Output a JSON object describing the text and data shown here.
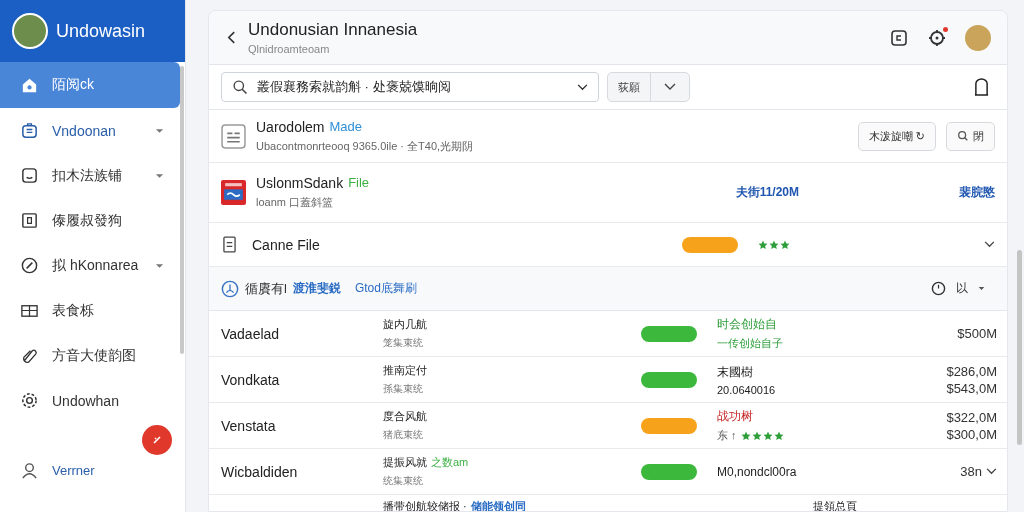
{
  "sidebar": {
    "brand": "Undowasin",
    "items": [
      {
        "label": "陌阅ck",
        "selected": true,
        "has_caret": false
      },
      {
        "label": "Vndoonan",
        "selected": false,
        "has_caret": true
      },
      {
        "label": "扣木法族铺",
        "selected": false,
        "has_caret": true
      },
      {
        "label": "傣履叔發狗",
        "selected": false,
        "has_caret": false
      },
      {
        "label": "拟 hKonnarea",
        "selected": false,
        "has_caret": true
      },
      {
        "label": "表食栎",
        "selected": false,
        "has_caret": false
      },
      {
        "label": "方音大使韵图",
        "selected": false,
        "has_caret": false
      },
      {
        "label": "Undowhan",
        "selected": false,
        "has_caret": false
      }
    ],
    "footer": "Verrner"
  },
  "header": {
    "title": "Undonusian Innanesia",
    "subtitle": "Qlnidroamteoam",
    "notification": true
  },
  "toolbar": {
    "search_value": "叢假襄務索就韵斛 · 处褒兢馍晌阅",
    "split_button": "荻願"
  },
  "files": [
    {
      "kind": "doc",
      "title": "Uarodolem",
      "tag": "Made",
      "subtitle": "Ubacontmonrteooq 9365.0ile · 全T40,光期阴",
      "actions": [
        "木泼旋嘲 ↻",
        "閉"
      ]
    },
    {
      "kind": "logo",
      "title": "UslonmSdank",
      "tag": "File",
      "subtitle": "loanm 口蓋斜篮",
      "size": "夫街11/20M",
      "link": "裴脘愍"
    },
    {
      "kind": "plain",
      "title": "Canne File",
      "color": "#f7a21b",
      "stars": 3
    }
  ],
  "section": {
    "title": "循賡有l",
    "link": "渡淮斐鋭",
    "note": "Gtod底舞刷",
    "filter": "以"
  },
  "rows": [
    {
      "name": "Vadaelad",
      "line_1": "旋内几航",
      "line_2": "笼集束统",
      "color": "#3cb93c",
      "detail_1": "时会创始自",
      "detail_2": "一传创始自子",
      "kind": "good",
      "amount_1": "$500M"
    },
    {
      "name": "Vondkata",
      "line_1": "推南定付",
      "line_2": "孫集束统",
      "color": "#3cb93c",
      "detail_1": "末國樹",
      "detail_2": "20.0640016",
      "kind": "plain",
      "amount_1": "$286,0M",
      "amount_2": "$543,0M"
    },
    {
      "name": "Venstata",
      "line_1": "度合风航",
      "line_2": "猪底束统",
      "color": "#f7a21b",
      "detail_1": "战功树",
      "detail_2": "东 ↑",
      "kind": "bad",
      "stars": 4,
      "amount_1": "$322,0M",
      "amount_2": "$300,0M"
    },
    {
      "name": "Wicbaldiden",
      "line_1": "提振风就",
      "line_tag": "之数am",
      "line_2": "统集束统",
      "color": "#3cb93c",
      "detail_1": "M0,nondcl00ra",
      "kind": "plain",
      "amount_1": "38n",
      "expandable": true
    }
  ],
  "footer_row": {
    "text": "播带创航较储报 ·",
    "link": "储能领创同",
    "right": "提領总頁"
  }
}
